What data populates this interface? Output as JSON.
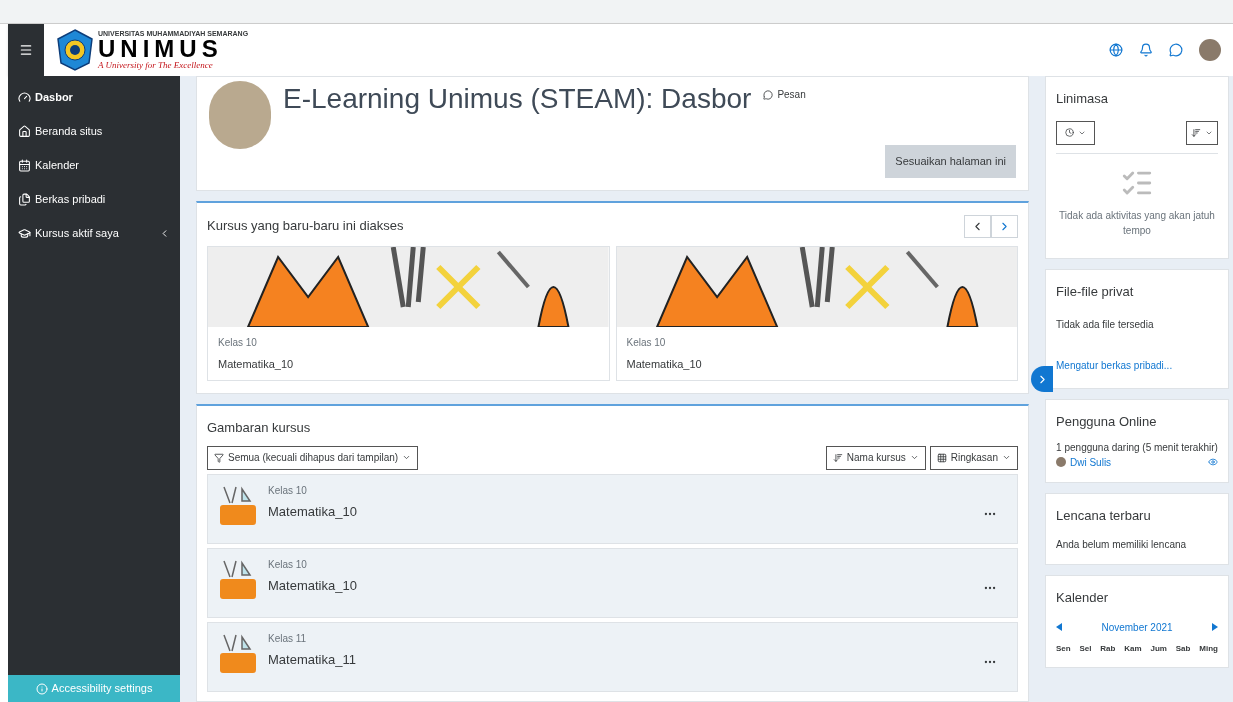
{
  "navbar": {
    "university": "UNIVERSITAS MUHAMMADIYAH SEMARANG",
    "name": "UNIMUS",
    "tagline": "A University for The Excellence"
  },
  "sidebar": {
    "items": [
      {
        "label": "Dasbor",
        "selected": true,
        "expandable": false
      },
      {
        "label": "Beranda situs",
        "selected": false,
        "expandable": false
      },
      {
        "label": "Kalender",
        "selected": false,
        "expandable": false
      },
      {
        "label": "Berkas pribadi",
        "selected": false,
        "expandable": false
      },
      {
        "label": "Kursus aktif saya",
        "selected": false,
        "expandable": true
      }
    ],
    "accessibility_button": "Accessibility settings"
  },
  "header": {
    "title": "E-Learning Unimus (STEAM): Dasbor",
    "message_link": "Pesan",
    "customize_button": "Sesuaikan halaman ini"
  },
  "recent_courses": {
    "title": "Kursus yang baru-baru ini diakses",
    "cards": [
      {
        "category": "Kelas 10",
        "name": "Matematika_10"
      },
      {
        "category": "Kelas 10",
        "name": "Matematika_10"
      }
    ]
  },
  "course_overview": {
    "title": "Gambaran kursus",
    "filter": "Semua (kecuali dihapus dari tampilan)",
    "sort": "Nama kursus",
    "view": "Ringkasan",
    "courses": [
      {
        "category": "Kelas 10",
        "name": "Matematika_10"
      },
      {
        "category": "Kelas 10",
        "name": "Matematika_10"
      },
      {
        "category": "Kelas 11",
        "name": "Matematika_11"
      }
    ]
  },
  "blocks": {
    "timeline": {
      "title": "Linimasa",
      "empty_text": "Tidak ada aktivitas yang akan jatuh tempo"
    },
    "private_files": {
      "title": "File-file privat",
      "text": "Tidak ada file tersedia",
      "link": "Mengatur berkas pribadi..."
    },
    "online_users": {
      "title": "Pengguna Online",
      "summary": "1 pengguna daring (5 menit terakhir)",
      "users": [
        {
          "name": "Dwi Sulis"
        }
      ]
    },
    "badges": {
      "title": "Lencana terbaru",
      "text": "Anda belum memiliki lencana"
    },
    "calendar": {
      "title": "Kalender",
      "month": "November 2021",
      "weekdays": [
        "Sen",
        "Sel",
        "Rab",
        "Kam",
        "Jum",
        "Sab",
        "Ming"
      ]
    }
  }
}
